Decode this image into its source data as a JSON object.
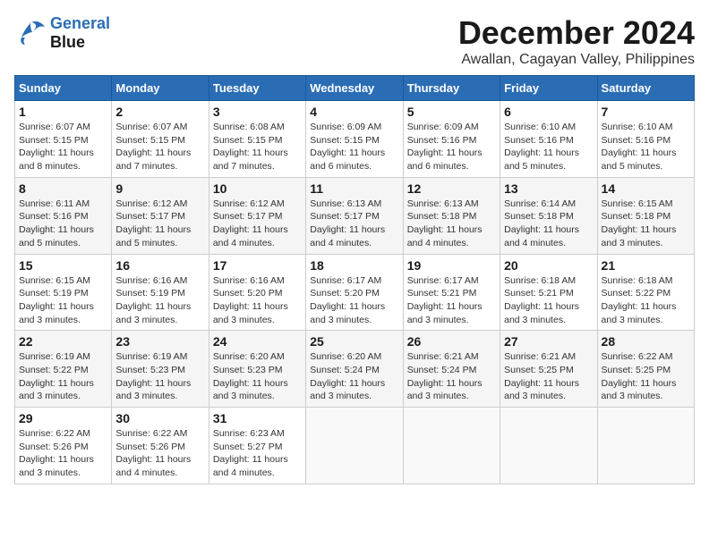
{
  "header": {
    "logo_line1": "General",
    "logo_line2": "Blue",
    "month_year": "December 2024",
    "location": "Awallan, Cagayan Valley, Philippines"
  },
  "days_of_week": [
    "Sunday",
    "Monday",
    "Tuesday",
    "Wednesday",
    "Thursday",
    "Friday",
    "Saturday"
  ],
  "weeks": [
    [
      {
        "day": "1",
        "sunrise": "Sunrise: 6:07 AM",
        "sunset": "Sunset: 5:15 PM",
        "daylight": "Daylight: 11 hours and 8 minutes."
      },
      {
        "day": "2",
        "sunrise": "Sunrise: 6:07 AM",
        "sunset": "Sunset: 5:15 PM",
        "daylight": "Daylight: 11 hours and 7 minutes."
      },
      {
        "day": "3",
        "sunrise": "Sunrise: 6:08 AM",
        "sunset": "Sunset: 5:15 PM",
        "daylight": "Daylight: 11 hours and 7 minutes."
      },
      {
        "day": "4",
        "sunrise": "Sunrise: 6:09 AM",
        "sunset": "Sunset: 5:15 PM",
        "daylight": "Daylight: 11 hours and 6 minutes."
      },
      {
        "day": "5",
        "sunrise": "Sunrise: 6:09 AM",
        "sunset": "Sunset: 5:16 PM",
        "daylight": "Daylight: 11 hours and 6 minutes."
      },
      {
        "day": "6",
        "sunrise": "Sunrise: 6:10 AM",
        "sunset": "Sunset: 5:16 PM",
        "daylight": "Daylight: 11 hours and 5 minutes."
      },
      {
        "day": "7",
        "sunrise": "Sunrise: 6:10 AM",
        "sunset": "Sunset: 5:16 PM",
        "daylight": "Daylight: 11 hours and 5 minutes."
      }
    ],
    [
      {
        "day": "8",
        "sunrise": "Sunrise: 6:11 AM",
        "sunset": "Sunset: 5:16 PM",
        "daylight": "Daylight: 11 hours and 5 minutes."
      },
      {
        "day": "9",
        "sunrise": "Sunrise: 6:12 AM",
        "sunset": "Sunset: 5:17 PM",
        "daylight": "Daylight: 11 hours and 5 minutes."
      },
      {
        "day": "10",
        "sunrise": "Sunrise: 6:12 AM",
        "sunset": "Sunset: 5:17 PM",
        "daylight": "Daylight: 11 hours and 4 minutes."
      },
      {
        "day": "11",
        "sunrise": "Sunrise: 6:13 AM",
        "sunset": "Sunset: 5:17 PM",
        "daylight": "Daylight: 11 hours and 4 minutes."
      },
      {
        "day": "12",
        "sunrise": "Sunrise: 6:13 AM",
        "sunset": "Sunset: 5:18 PM",
        "daylight": "Daylight: 11 hours and 4 minutes."
      },
      {
        "day": "13",
        "sunrise": "Sunrise: 6:14 AM",
        "sunset": "Sunset: 5:18 PM",
        "daylight": "Daylight: 11 hours and 4 minutes."
      },
      {
        "day": "14",
        "sunrise": "Sunrise: 6:15 AM",
        "sunset": "Sunset: 5:18 PM",
        "daylight": "Daylight: 11 hours and 3 minutes."
      }
    ],
    [
      {
        "day": "15",
        "sunrise": "Sunrise: 6:15 AM",
        "sunset": "Sunset: 5:19 PM",
        "daylight": "Daylight: 11 hours and 3 minutes."
      },
      {
        "day": "16",
        "sunrise": "Sunrise: 6:16 AM",
        "sunset": "Sunset: 5:19 PM",
        "daylight": "Daylight: 11 hours and 3 minutes."
      },
      {
        "day": "17",
        "sunrise": "Sunrise: 6:16 AM",
        "sunset": "Sunset: 5:20 PM",
        "daylight": "Daylight: 11 hours and 3 minutes."
      },
      {
        "day": "18",
        "sunrise": "Sunrise: 6:17 AM",
        "sunset": "Sunset: 5:20 PM",
        "daylight": "Daylight: 11 hours and 3 minutes."
      },
      {
        "day": "19",
        "sunrise": "Sunrise: 6:17 AM",
        "sunset": "Sunset: 5:21 PM",
        "daylight": "Daylight: 11 hours and 3 minutes."
      },
      {
        "day": "20",
        "sunrise": "Sunrise: 6:18 AM",
        "sunset": "Sunset: 5:21 PM",
        "daylight": "Daylight: 11 hours and 3 minutes."
      },
      {
        "day": "21",
        "sunrise": "Sunrise: 6:18 AM",
        "sunset": "Sunset: 5:22 PM",
        "daylight": "Daylight: 11 hours and 3 minutes."
      }
    ],
    [
      {
        "day": "22",
        "sunrise": "Sunrise: 6:19 AM",
        "sunset": "Sunset: 5:22 PM",
        "daylight": "Daylight: 11 hours and 3 minutes."
      },
      {
        "day": "23",
        "sunrise": "Sunrise: 6:19 AM",
        "sunset": "Sunset: 5:23 PM",
        "daylight": "Daylight: 11 hours and 3 minutes."
      },
      {
        "day": "24",
        "sunrise": "Sunrise: 6:20 AM",
        "sunset": "Sunset: 5:23 PM",
        "daylight": "Daylight: 11 hours and 3 minutes."
      },
      {
        "day": "25",
        "sunrise": "Sunrise: 6:20 AM",
        "sunset": "Sunset: 5:24 PM",
        "daylight": "Daylight: 11 hours and 3 minutes."
      },
      {
        "day": "26",
        "sunrise": "Sunrise: 6:21 AM",
        "sunset": "Sunset: 5:24 PM",
        "daylight": "Daylight: 11 hours and 3 minutes."
      },
      {
        "day": "27",
        "sunrise": "Sunrise: 6:21 AM",
        "sunset": "Sunset: 5:25 PM",
        "daylight": "Daylight: 11 hours and 3 minutes."
      },
      {
        "day": "28",
        "sunrise": "Sunrise: 6:22 AM",
        "sunset": "Sunset: 5:25 PM",
        "daylight": "Daylight: 11 hours and 3 minutes."
      }
    ],
    [
      {
        "day": "29",
        "sunrise": "Sunrise: 6:22 AM",
        "sunset": "Sunset: 5:26 PM",
        "daylight": "Daylight: 11 hours and 3 minutes."
      },
      {
        "day": "30",
        "sunrise": "Sunrise: 6:22 AM",
        "sunset": "Sunset: 5:26 PM",
        "daylight": "Daylight: 11 hours and 4 minutes."
      },
      {
        "day": "31",
        "sunrise": "Sunrise: 6:23 AM",
        "sunset": "Sunset: 5:27 PM",
        "daylight": "Daylight: 11 hours and 4 minutes."
      },
      null,
      null,
      null,
      null
    ]
  ]
}
